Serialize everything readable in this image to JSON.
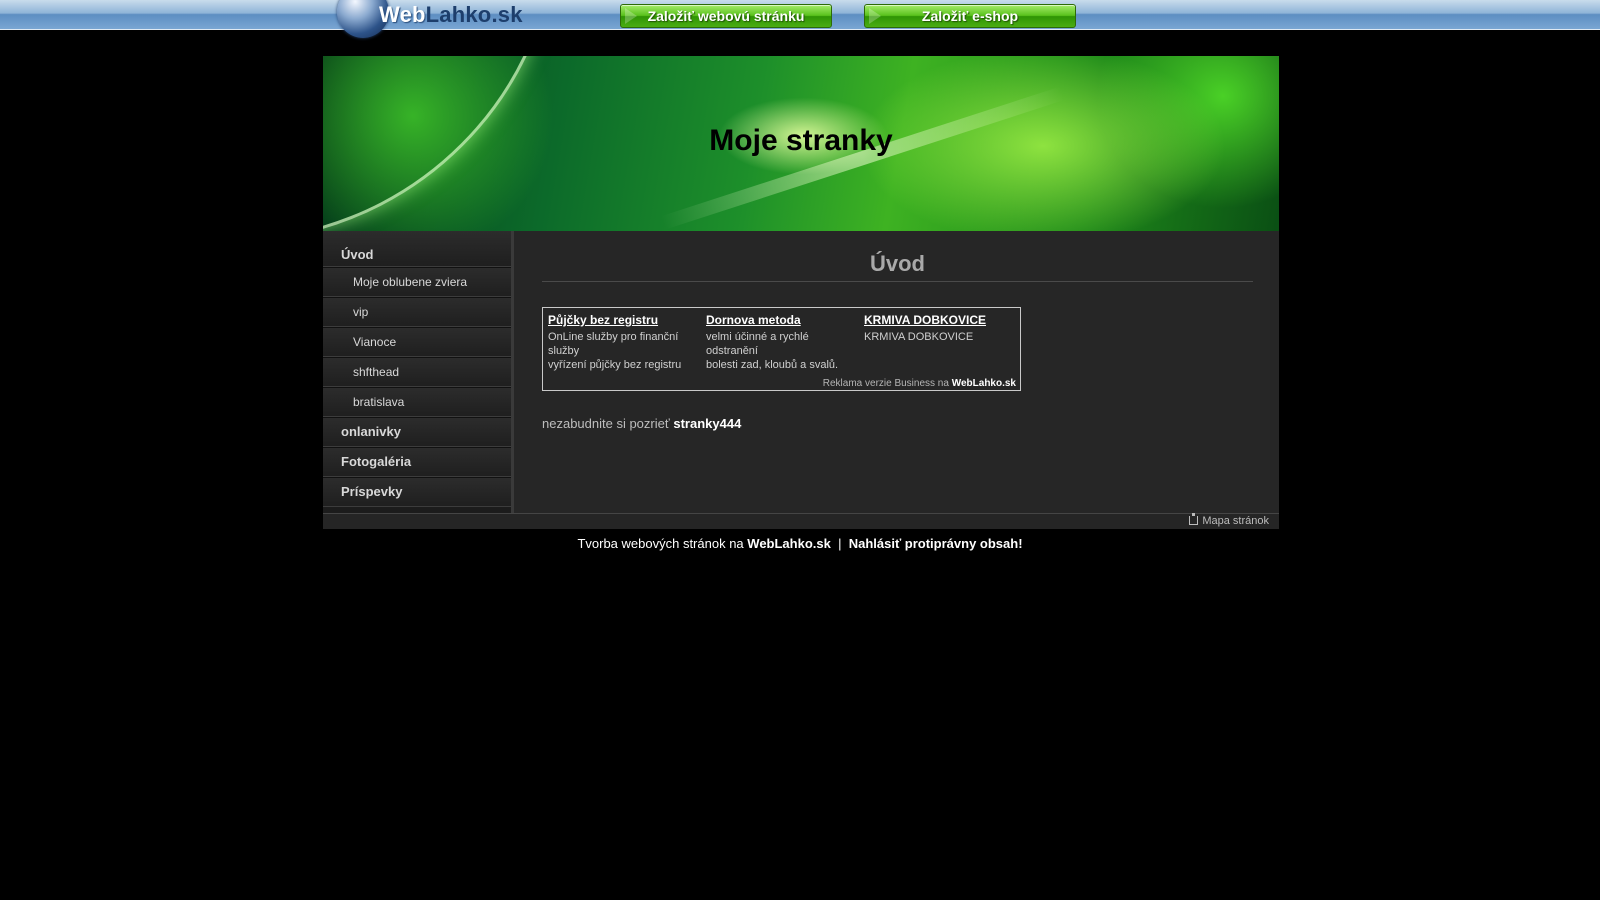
{
  "topbar": {
    "logo": {
      "part1": "Web",
      "part2": "Lahko.sk"
    },
    "button_website": "Založiť webovú stránku",
    "button_eshop": "Založiť e-shop"
  },
  "header": {
    "site_title": "Moje stranky"
  },
  "sidebar": {
    "items": [
      {
        "label": "Úvod",
        "level": "main"
      },
      {
        "label": "Moje oblubene zviera",
        "level": "sub"
      },
      {
        "label": "vip",
        "level": "sub"
      },
      {
        "label": "Vianoce",
        "level": "sub"
      },
      {
        "label": "shfthead",
        "level": "sub"
      },
      {
        "label": "bratislava",
        "level": "sub"
      },
      {
        "label": "onlanivky",
        "level": "main"
      },
      {
        "label": "Fotogaléria",
        "level": "main"
      },
      {
        "label": "Príspevky",
        "level": "main"
      }
    ]
  },
  "content": {
    "title": "Úvod",
    "ads": [
      {
        "title": "Půjčky bez registru",
        "lines": [
          "OnLine služby pro finanční služby",
          "vyřízení půjčky bez registru"
        ]
      },
      {
        "title": "Dornova metoda",
        "lines": [
          "velmi účinné a rychlé odstranění",
          "bolesti zad, kloubů a svalů."
        ]
      },
      {
        "title": "KRMIVA DOBKOVICE",
        "lines": [
          "KRMIVA DOBKOVICE"
        ]
      }
    ],
    "ad_footer_prefix": "Reklama verzie Business na",
    "ad_footer_link": "WebLahko.sk",
    "reminder_prefix": "nezabudnite si pozrieť",
    "reminder_link": "stranky444"
  },
  "footer": {
    "sitemap_label": "Mapa stránok",
    "credit_prefix": "Tvorba webových stránok na",
    "credit_link": "WebLahko.sk",
    "separator": "|",
    "report_link": "Nahlásiť protiprávny obsah!"
  }
}
